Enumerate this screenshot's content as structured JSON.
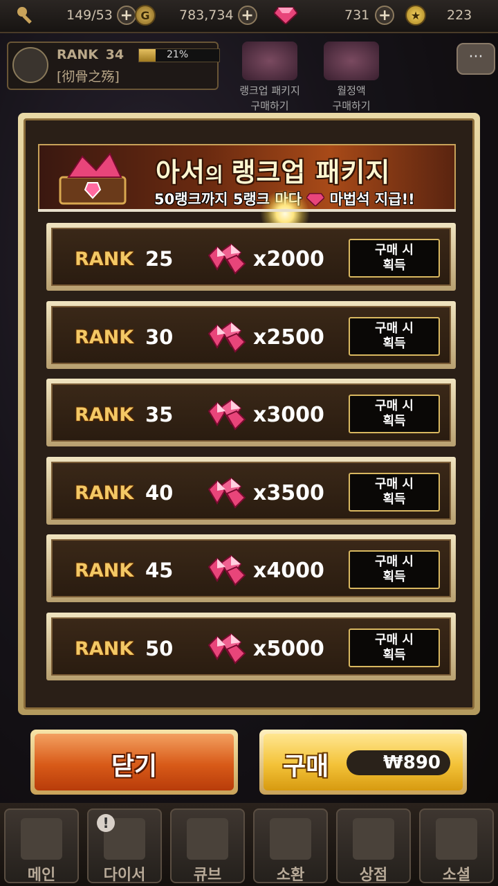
{
  "topbar": {
    "stamina": "149/53",
    "gold": "783,734",
    "gems": "731",
    "medals": "223",
    "gold_symbol": "G"
  },
  "profile": {
    "rank_label": "RANK",
    "rank_value": "34",
    "exp_percent": "21%",
    "exp_fraction": 0.21,
    "guild_name": "[彻骨之殇]"
  },
  "packages": [
    {
      "label": "랭크업 패키지\n구매하기"
    },
    {
      "label": "월정액\n구매하기"
    }
  ],
  "chat_icon": "chat-bubble-icon",
  "dialog": {
    "title_part1": "아서",
    "title_part2": "의 ",
    "title_part3": "랭크업 패키지",
    "subtitle": "50랭크까지 5랭크 마다",
    "subtitle_end": "마법석 지급!!",
    "rows": [
      {
        "rank_word": "RANK",
        "rank": "25",
        "amount": "x2000",
        "button": "구매 시\n획득"
      },
      {
        "rank_word": "RANK",
        "rank": "30",
        "amount": "x2500",
        "button": "구매 시\n획득"
      },
      {
        "rank_word": "RANK",
        "rank": "35",
        "amount": "x3000",
        "button": "구매 시\n획득"
      },
      {
        "rank_word": "RANK",
        "rank": "40",
        "amount": "x3500",
        "button": "구매 시\n획득"
      },
      {
        "rank_word": "RANK",
        "rank": "45",
        "amount": "x4000",
        "button": "구매 시\n획득"
      },
      {
        "rank_word": "RANK",
        "rank": "50",
        "amount": "x5000",
        "button": "구매 시\n획득"
      }
    ]
  },
  "buttons": {
    "close": "닫기",
    "buy": "구매",
    "price": "₩890"
  },
  "nav": [
    {
      "label": "메인",
      "icon": "castle-icon"
    },
    {
      "label": "다이서",
      "icon": "character-icon",
      "alert": "!"
    },
    {
      "label": "큐브",
      "icon": "cube-icon"
    },
    {
      "label": "소환",
      "icon": "summon-icon"
    },
    {
      "label": "상점",
      "icon": "money-bag-icon"
    },
    {
      "label": "소셜",
      "icon": "handshake-icon"
    }
  ],
  "colors": {
    "rank_gold": "#f3c865",
    "close_orange": "#d85a18",
    "buy_yellow": "#f3c238",
    "frame_gold": "#c9a35a"
  }
}
